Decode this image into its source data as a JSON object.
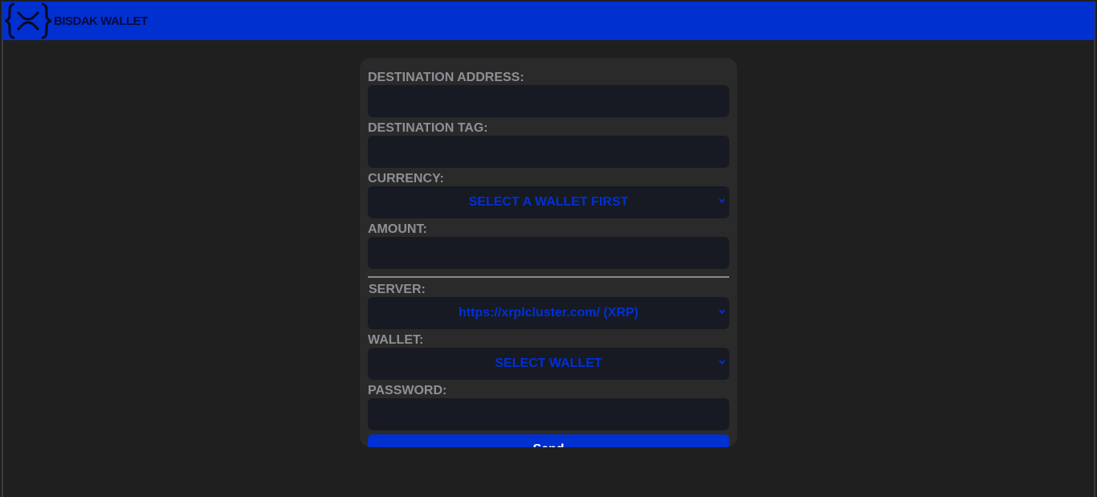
{
  "header": {
    "brand": "BISDAK WALLET",
    "logo_icon": "xrp-logo-icon",
    "background": "#0030d0"
  },
  "form": {
    "destination_address_label": "DESTINATION ADDRESS:",
    "destination_address_value": "",
    "destination_tag_label": "DESTINATION TAG:",
    "destination_tag_value": "",
    "currency_label": "CURRENCY:",
    "currency_selected": "SELECT A WALLET FIRST",
    "amount_label": "AMOUNT:",
    "amount_value": "",
    "server_label": "SERVER:",
    "server_selected": "https://xrplcluster.com/ (XRP)",
    "wallet_label": "WALLET:",
    "wallet_selected": "SELECT WALLET",
    "password_label": "PASSWORD:",
    "password_value": "",
    "send_label": "Send"
  },
  "colors": {
    "accent": "#0030d0",
    "panel": "#2a2a2a",
    "input": "#171a22",
    "page": "#1f1f1f",
    "label": "#8f8f96"
  }
}
